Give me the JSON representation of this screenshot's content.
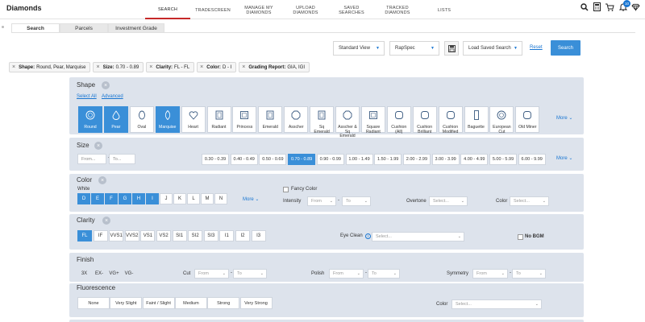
{
  "header": {
    "brand": "Diamonds",
    "nav": [
      "SEARCH",
      "TRADESCREEN",
      "MANAGE MY\nDIAMONDS",
      "UPLOAD\nDIAMONDS",
      "SAVED\nSEARCHES",
      "TRACKED\nDIAMONDS",
      "LISTS"
    ],
    "active_nav": "SEARCH",
    "notification_count": "10",
    "icons": [
      "search-icon",
      "calculator-icon",
      "cart-icon",
      "bell-icon",
      "diamond-icon"
    ]
  },
  "tabs": [
    "Search",
    "Parcels",
    "Investment Grade"
  ],
  "toolbar": {
    "view": "Standard View",
    "spec": "RapSpec",
    "load": "Load Saved Search",
    "reset": "Reset",
    "search": "Search"
  },
  "chips": [
    {
      "label": "Shape:",
      "value": "Round, Pear, Marquise"
    },
    {
      "label": "Size:",
      "value": "0.70 - 0.89"
    },
    {
      "label": "Clarity:",
      "value": "FL - FL"
    },
    {
      "label": "Color:",
      "value": "D - I"
    },
    {
      "label": "Grading Report:",
      "value": "GIA, IGI"
    }
  ],
  "shape": {
    "title": "Shape",
    "select_all": "Select All",
    "advanced": "Advanced",
    "more": "More",
    "items": [
      "Round",
      "Pear",
      "Oval",
      "Marquise",
      "Heart",
      "Radiant",
      "Princess",
      "Emerald",
      "Asscher",
      "Sq\nEmerald",
      "Asscher &\nSq\nEmerald",
      "Square\nRadiant",
      "Cushion\n(All)",
      "Cushion\nBrilliant",
      "Cushion\nModified",
      "Baguette",
      "European\nCut",
      "Old Miner"
    ],
    "selected": [
      "Round",
      "Pear",
      "Marquise"
    ]
  },
  "size": {
    "title": "Size",
    "from_placeholder": "From...",
    "to_placeholder": "To...",
    "more": "More",
    "ranges": [
      "0.30 - 0.39",
      "0.40 - 0.49",
      "0.50 - 0.69",
      "0.70 - 0.89",
      "0.90 - 0.99",
      "1.00 - 1.49",
      "1.50 - 1.99",
      "2.00 - 2.99",
      "3.00 - 3.99",
      "4.00 - 4.99",
      "5.00 - 5.99",
      "6.00 - 9.99"
    ],
    "selected": "0.70 - 0.89"
  },
  "color": {
    "title": "Color",
    "white_label": "White",
    "grades": [
      "D",
      "E",
      "F",
      "G",
      "H",
      "I",
      "J",
      "K",
      "L",
      "M",
      "N"
    ],
    "selected": [
      "D",
      "E",
      "F",
      "G",
      "H",
      "I"
    ],
    "more": "More",
    "fancy_label": "Fancy Color",
    "intensity_label": "Intensity",
    "intensity_from": "From",
    "intensity_to": "To",
    "overtone_label": "Overtone",
    "overtone_value": "Select...",
    "color_label": "Color",
    "color_value": "Select..."
  },
  "clarity": {
    "title": "Clarity",
    "grades": [
      "FL",
      "IF",
      "VVS1",
      "VVS2",
      "VS1",
      "VS2",
      "SI1",
      "SI2",
      "SI3",
      "I1",
      "I2",
      "I3"
    ],
    "selected": [
      "FL"
    ],
    "eye_clean_label": "Eye Clean",
    "eye_clean_value": "Select...",
    "no_bgm": "No BGM"
  },
  "finish": {
    "title": "Finish",
    "presets": [
      "3X",
      "EX-",
      "VG+",
      "VG-"
    ],
    "cut_label": "Cut",
    "polish_label": "Polish",
    "symmetry_label": "Symmetry",
    "from": "From",
    "to": "To"
  },
  "fluorescence": {
    "title": "Fluorescence",
    "items": [
      "None",
      "Very Slight",
      "Faint / Slight",
      "Medium",
      "Strong",
      "Very Strong"
    ],
    "color_label": "Color",
    "color_value": "Select..."
  },
  "colors": {
    "accent": "#3a8fd8",
    "panel": "#dde3ec",
    "active_tab_underline": "#c62828"
  }
}
